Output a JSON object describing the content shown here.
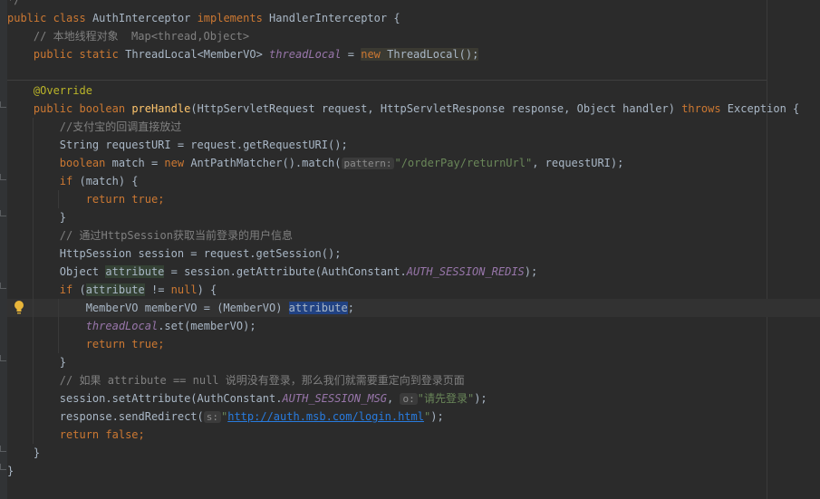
{
  "editor": {
    "class_decl": {
      "kw1": "public",
      "kw2": "class",
      "name": "AuthInterceptor",
      "kw3": "implements",
      "iface": "HandlerInterceptor",
      "brace": "{"
    },
    "comment_thread": "// 本地线程对象  Map<thread,Object>",
    "field_decl": {
      "kw1": "public",
      "kw2": "static",
      "type": "ThreadLocal<MemberVO>",
      "name": "threadLocal",
      "eq": "=",
      "kw_new": "new",
      "ctor": "ThreadLocal();"
    },
    "annotation": "@Override",
    "method_decl": {
      "kw1": "public",
      "kw2": "boolean",
      "name": "preHandle",
      "params": "(HttpServletRequest request, HttpServletResponse response, Object handler)",
      "kw3": "throws",
      "rest": "Exception {"
    },
    "comment_alipay": "//支付宝的回调直接放过",
    "line_uri": "String requestURI = request.getRequestURI();",
    "line_match": {
      "kw": "boolean",
      "pre": "match = ",
      "kw_new": "new",
      "mid": "AntPathMatcher().match(",
      "hint": "pattern:",
      "str": "\"/orderPay/returnUrl\"",
      "post": ", requestURI);"
    },
    "line_if_match": {
      "kw": "if",
      "rest": "(match) {"
    },
    "line_return_true1": {
      "kw1": "return",
      "kw2": "true",
      "semi": ";"
    },
    "close_brace": "}",
    "comment_session": "// 通过HttpSession获取当前登录的用户信息",
    "line_session": "HttpSession session = request.getSession();",
    "line_attr": {
      "pre": "Object ",
      "var": "attribute",
      "mid": " = session.getAttribute(AuthConstant.",
      "const": "AUTH_SESSION_REDIS",
      "post": ");"
    },
    "line_if_attr": {
      "kw": "if",
      "pre": "(",
      "var": "attribute",
      "mid": " != ",
      "kw_null": "null",
      "post": ") {"
    },
    "line_membervo": {
      "pre": "MemberVO memberVO = (MemberVO) ",
      "var": "attribute",
      "post": ";"
    },
    "line_threadlocal_set": {
      "fld": "threadLocal",
      "post": ".set(memberVO);"
    },
    "line_return_true2": {
      "kw1": "return",
      "kw2": "true",
      "semi": ";"
    },
    "comment_redirect": "// 如果 attribute == null 说明没有登录，那么我们就需要重定向到登录页面",
    "line_set_attr": {
      "pre": "session.setAttribute(AuthConstant.",
      "const": "AUTH_SESSION_MSG",
      "mid": ", ",
      "hint": "o:",
      "str": "\"请先登录\"",
      "post": ");"
    },
    "line_redirect": {
      "pre": "response.sendRedirect(",
      "hint": "s:",
      "q1": "\"",
      "url": "http://auth.msb.com/login.html",
      "q2": "\"",
      "post": ");"
    },
    "line_return_false": {
      "kw1": "return",
      "kw2": "false",
      "semi": ";"
    },
    "top_fragment": "*/"
  }
}
